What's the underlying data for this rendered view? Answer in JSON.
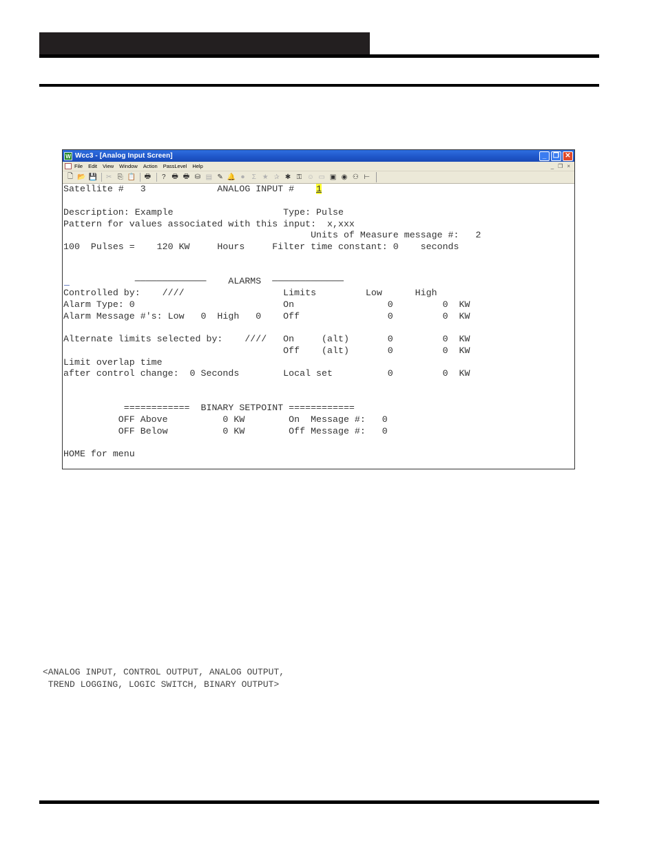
{
  "window": {
    "app_icon_letter": "W",
    "title": "Wcc3 - [Analog Input Screen]",
    "controls": {
      "minimize": "_",
      "restore": "❐",
      "close": "✕"
    }
  },
  "menu": {
    "items": [
      "File",
      "Edit",
      "View",
      "Window",
      "Action",
      "PassLevel",
      "Help"
    ],
    "mdi_controls": {
      "minimize": "_",
      "restore": "❐",
      "close": "×"
    }
  },
  "toolbar": {
    "buttons": [
      {
        "name": "new-icon",
        "glyph": "🗋",
        "enabled": true
      },
      {
        "name": "open-icon",
        "glyph": "📂",
        "enabled": true
      },
      {
        "name": "save-icon",
        "glyph": "💾",
        "enabled": true
      },
      {
        "sep": true
      },
      {
        "name": "cut-icon",
        "glyph": "✂",
        "enabled": false
      },
      {
        "name": "copy-icon",
        "glyph": "⎘",
        "enabled": true
      },
      {
        "name": "paste-icon",
        "glyph": "📋",
        "enabled": false
      },
      {
        "sep": true
      },
      {
        "name": "print-icon",
        "glyph": "🖶",
        "enabled": true
      },
      {
        "sep": true
      },
      {
        "name": "help-icon",
        "glyph": "?",
        "enabled": true
      },
      {
        "name": "print-green-icon",
        "glyph": "🖶",
        "enabled": true
      },
      {
        "name": "print-red-icon",
        "glyph": "🖶",
        "enabled": true
      },
      {
        "name": "network-icon",
        "glyph": "⛁",
        "enabled": true
      },
      {
        "name": "copy-page-icon",
        "glyph": "▤",
        "enabled": false
      },
      {
        "name": "edit-page-icon",
        "glyph": "✎",
        "enabled": true
      },
      {
        "name": "bell-icon",
        "glyph": "🔔",
        "enabled": false
      },
      {
        "name": "alarm-icon",
        "glyph": "⏺",
        "enabled": false
      },
      {
        "name": "sigma-icon",
        "glyph": "Σ",
        "enabled": false
      },
      {
        "name": "star-icon",
        "glyph": "★",
        "enabled": false
      },
      {
        "name": "star-add-icon",
        "glyph": "✰",
        "enabled": false
      },
      {
        "name": "badge-icon",
        "glyph": "✱",
        "enabled": true
      },
      {
        "name": "key-icon",
        "glyph": "⚿",
        "enabled": true
      },
      {
        "name": "person-icon",
        "glyph": "☺",
        "enabled": false
      },
      {
        "name": "chart-icon",
        "glyph": "▭",
        "enabled": false
      },
      {
        "name": "color-palette-icon",
        "glyph": "▣",
        "enabled": true
      },
      {
        "name": "eye-icon",
        "glyph": "◉",
        "enabled": true
      },
      {
        "name": "wan-icon",
        "glyph": "⚇",
        "enabled": true
      },
      {
        "name": "tree-icon",
        "glyph": "⊢",
        "enabled": true
      }
    ]
  },
  "screen": {
    "rows": [
      {
        "id": "satellite-row",
        "text": "Satellite #   3             ANALOG INPUT #    ",
        "highlight": "1"
      },
      {
        "id": "description-row",
        "text": "Description: Example                    Type: Pulse"
      },
      {
        "id": "pattern-row",
        "text": "Pattern for values associated with this input:  x,xxx"
      },
      {
        "id": "units-row",
        "text": "                                             Units of Measure message #:   2"
      },
      {
        "id": "pulses-row",
        "text": "100  Pulses =    120 KW     Hours     Filter time constant: 0    seconds"
      },
      {
        "id": "alarms-header-row",
        "text": "             ─────────────    ALARMS  ─────────────"
      },
      {
        "id": "controlled-by-row",
        "text": "Controlled by:    ////                  Limits         Low      High"
      },
      {
        "id": "alarm-type-row",
        "text": "Alarm Type: 0                           On                 0         0  KW"
      },
      {
        "id": "alarm-message-row",
        "text": "Alarm Message #'s: Low   0  High   0    Off                0         0  KW"
      },
      {
        "id": "alternate-limits-row",
        "text": "Alternate limits selected by:    ////   On     (alt)       0         0  KW"
      },
      {
        "id": "off-alt-row",
        "text": "                                        Off    (alt)       0         0  KW"
      },
      {
        "id": "limit-overlap-row",
        "text": "Limit overlap time"
      },
      {
        "id": "control-change-row",
        "text": "after control change:  0 Seconds        Local set          0         0  KW"
      },
      {
        "id": "binary-setpoint-header-row",
        "text": "           ============  BINARY SETPOINT ============"
      },
      {
        "id": "off-above-row",
        "text": "          OFF Above          0 KW        On  Message #:   0"
      },
      {
        "id": "off-below-row",
        "text": "          OFF Below          0 KW        Off Message #:   0"
      },
      {
        "id": "home-menu-row",
        "text": "HOME for menu"
      }
    ],
    "fields": {
      "satellite_number": "3",
      "analog_input_number": "1",
      "description": "Example",
      "type": "Pulse",
      "pattern": "x,xxx",
      "units_of_measure_message": "2",
      "pulses": "100",
      "kw_value": "120",
      "units": "KW",
      "time_base": "Hours",
      "filter_time_constant": "0",
      "filter_time_units": "seconds",
      "controlled_by": "////",
      "alarm_type": "0",
      "alarm_message_low": "0",
      "alarm_message_high": "0",
      "alternate_limits_selected_by": "////",
      "limit_overlap_time": "0 Seconds",
      "limits": [
        {
          "label": "On",
          "low": "0",
          "high": "0",
          "unit": "KW"
        },
        {
          "label": "Off",
          "low": "0",
          "high": "0",
          "unit": "KW"
        },
        {
          "label": "On (alt)",
          "low": "0",
          "high": "0",
          "unit": "KW"
        },
        {
          "label": "Off (alt)",
          "low": "0",
          "high": "0",
          "unit": "KW"
        },
        {
          "label": "Local set",
          "low": "0",
          "high": "0",
          "unit": "KW"
        }
      ],
      "binary_setpoint": {
        "off_above": "0 KW",
        "off_below": "0 KW",
        "on_message": "0",
        "off_message": "0"
      }
    }
  },
  "footnote": {
    "line1": "<ANALOG INPUT, CONTROL OUTPUT, ANALOG OUTPUT,",
    "line2": " TREND LOGGING, LOGIC SWITCH, BINARY OUTPUT>"
  }
}
